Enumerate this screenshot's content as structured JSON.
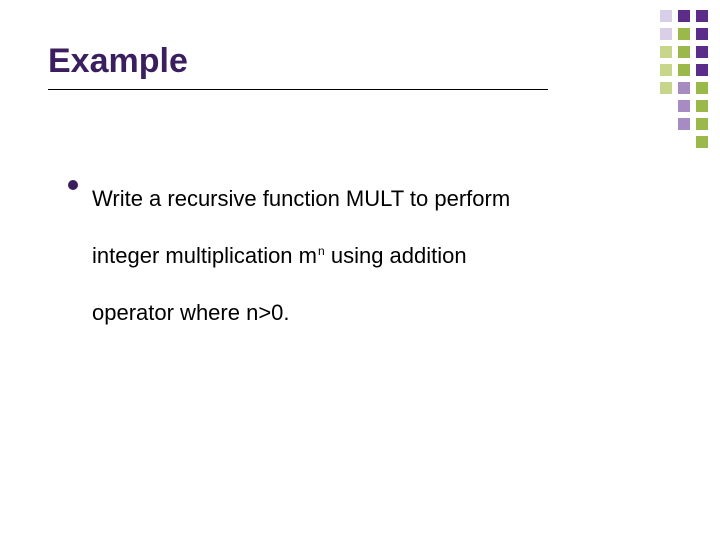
{
  "title": "Example",
  "body": {
    "line1": "Write a recursive function MULT to perform",
    "line2a": "integer multiplication m",
    "line2_sup": "n",
    "line2b": " using addition",
    "line3": "operator where n>0."
  }
}
